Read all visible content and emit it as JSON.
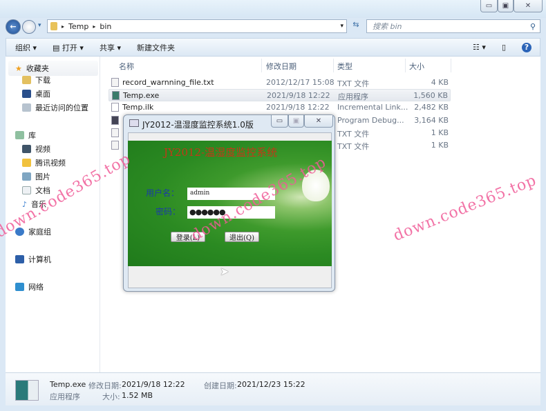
{
  "window": {
    "controls": [
      "minimize",
      "maximize",
      "close"
    ]
  },
  "address": {
    "path": [
      "Temp",
      "bin"
    ],
    "search_placeholder": "搜索 bin"
  },
  "toolbar": {
    "organize": "组织 ▾",
    "open": "打开 ▾",
    "share": "共享 ▾",
    "new_folder": "新建文件夹"
  },
  "columns": {
    "name": "名称",
    "date": "修改日期",
    "type": "类型",
    "size": "大小"
  },
  "sidebar": {
    "favorites": "收藏夹",
    "downloads": "下载",
    "desktop": "桌面",
    "recent": "最近访问的位置",
    "libraries": "库",
    "videos": "视频",
    "tencent_video": "腾讯视频",
    "pictures": "图片",
    "documents": "文档",
    "music": "音乐",
    "homegroup": "家庭组",
    "computer": "计算机",
    "network": "网络"
  },
  "files": [
    {
      "name": "record_warnning_file.txt",
      "date": "2012/12/17 15:08",
      "type": "TXT 文件",
      "size": "4 KB"
    },
    {
      "name": "Temp.exe",
      "date": "2021/9/18 12:22",
      "type": "应用程序",
      "size": "1,560 KB"
    },
    {
      "name": "Temp.ilk",
      "date": "2021/9/18 12:22",
      "type": "Incremental Link...",
      "size": "2,482 KB"
    },
    {
      "name": "",
      "date": "",
      "type": "Program Debug...",
      "size": "3,164 KB"
    },
    {
      "name": "",
      "date": "",
      "type": "TXT 文件",
      "size": "1 KB"
    },
    {
      "name": "",
      "date": "",
      "type": "TXT 文件",
      "size": "1 KB"
    }
  ],
  "status": {
    "name": "Temp.exe",
    "modified_label": "修改日期:",
    "modified": "2021/9/18 12:22",
    "created_label": "创建日期:",
    "created": "2021/12/23 15:22",
    "type": "应用程序",
    "size_label": "大小:",
    "size": "1.52 MB"
  },
  "dialog": {
    "title": "JY2012-温湿度监控系统1.0版",
    "banner": "JY2012-温湿度监控系统",
    "user_label": "用户名：",
    "user_value": "admin",
    "pwd_label": "密码：",
    "pwd_value": "●●●●●●",
    "login": "登录(L)",
    "exit": "退出(Q)"
  },
  "watermark": "down.code365.top"
}
